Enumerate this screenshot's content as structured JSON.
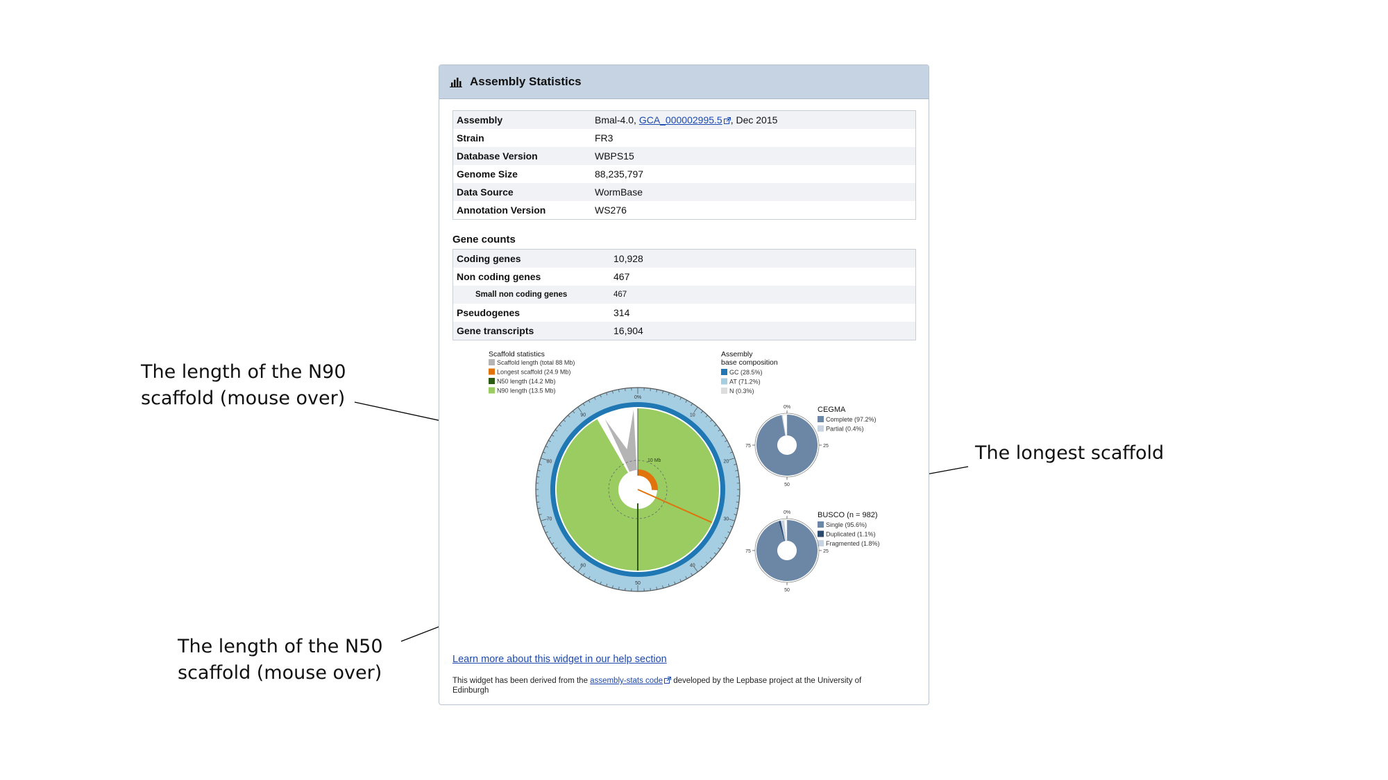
{
  "panel": {
    "title": "Assembly Statistics",
    "icon": "bar-chart-icon"
  },
  "assembly": {
    "rows": [
      {
        "key": "Assembly",
        "value_prefix": "Bmal-4.0, ",
        "link": "GCA_000002995.5",
        "value_suffix": ", Dec 2015"
      },
      {
        "key": "Strain",
        "value": "FR3"
      },
      {
        "key": "Database Version",
        "value": "WBPS15"
      },
      {
        "key": "Genome Size",
        "value": "88,235,797"
      },
      {
        "key": "Data Source",
        "value": "WormBase"
      },
      {
        "key": "Annotation Version",
        "value": "WS276"
      }
    ]
  },
  "gene_counts": {
    "title": "Gene counts",
    "rows": [
      {
        "key": "Coding genes",
        "value": "10,928"
      },
      {
        "key": "Non coding genes",
        "value": "467"
      },
      {
        "key": "Small non coding genes",
        "value": "467"
      },
      {
        "key": "Pseudogenes",
        "value": "314"
      },
      {
        "key": "Gene transcripts",
        "value": "16,904"
      }
    ]
  },
  "chart_data": [
    {
      "type": "pie",
      "title": "Scaffold statistics",
      "legend": [
        {
          "label": "Scaffold length (total 88 Mb)",
          "color": "#b4b4b4"
        },
        {
          "label": "Longest scaffold (24.9 Mb)",
          "color": "#e0730c"
        },
        {
          "label": "N50 length (14.2 Mb)",
          "color": "#2c5b14"
        },
        {
          "label": "N90 length (13.5 Mb)",
          "color": "#9acc62"
        }
      ],
      "radial_label": "10 Mb",
      "ring_ticks": [
        "0%",
        "10",
        "20",
        "30",
        "40",
        "50",
        "60",
        "70",
        "80",
        "90"
      ]
    },
    {
      "type": "pie",
      "title": "Assembly",
      "subtitle": "base composition",
      "legend": [
        {
          "label": "GC (28.5%)",
          "color": "#1f78b4",
          "value": 28.5
        },
        {
          "label": "AT (71.2%)",
          "color": "#a6cee3",
          "value": 71.2
        },
        {
          "label": "N (0.3%)",
          "color": "#dddddd",
          "value": 0.3
        }
      ]
    },
    {
      "type": "pie",
      "title": "CEGMA",
      "legend": [
        {
          "label": "Complete (97.2%)",
          "color": "#6c87a6",
          "value": 97.2
        },
        {
          "label": "Partial (0.4%)",
          "color": "#c8d4e2",
          "value": 0.4
        }
      ],
      "tick_labels": [
        "0%",
        "25",
        "50",
        "75"
      ]
    },
    {
      "type": "pie",
      "title": "BUSCO (n = 982)",
      "legend": [
        {
          "label": "Single (95.6%)",
          "color": "#6c87a6",
          "value": 95.6
        },
        {
          "label": "Duplicated (1.1%)",
          "color": "#2c4a6e",
          "value": 1.1
        },
        {
          "label": "Fragmented (1.8%)",
          "color": "#c8d4e2",
          "value": 1.8
        }
      ],
      "tick_labels": [
        "0%",
        "25",
        "50",
        "75"
      ]
    }
  ],
  "help_link": "Learn more about this widget in our help section",
  "footer": {
    "prefix": "This widget has been derived from the ",
    "link": "assembly-stats code",
    "suffix": " developed by the Lepbase project at the University of Edinburgh"
  },
  "annotations": {
    "n90": "The length of the N90 scaffold (mouse over)",
    "longest": "The longest scaffold",
    "n50": "The length of the N50 scaffold (mouse over)"
  }
}
